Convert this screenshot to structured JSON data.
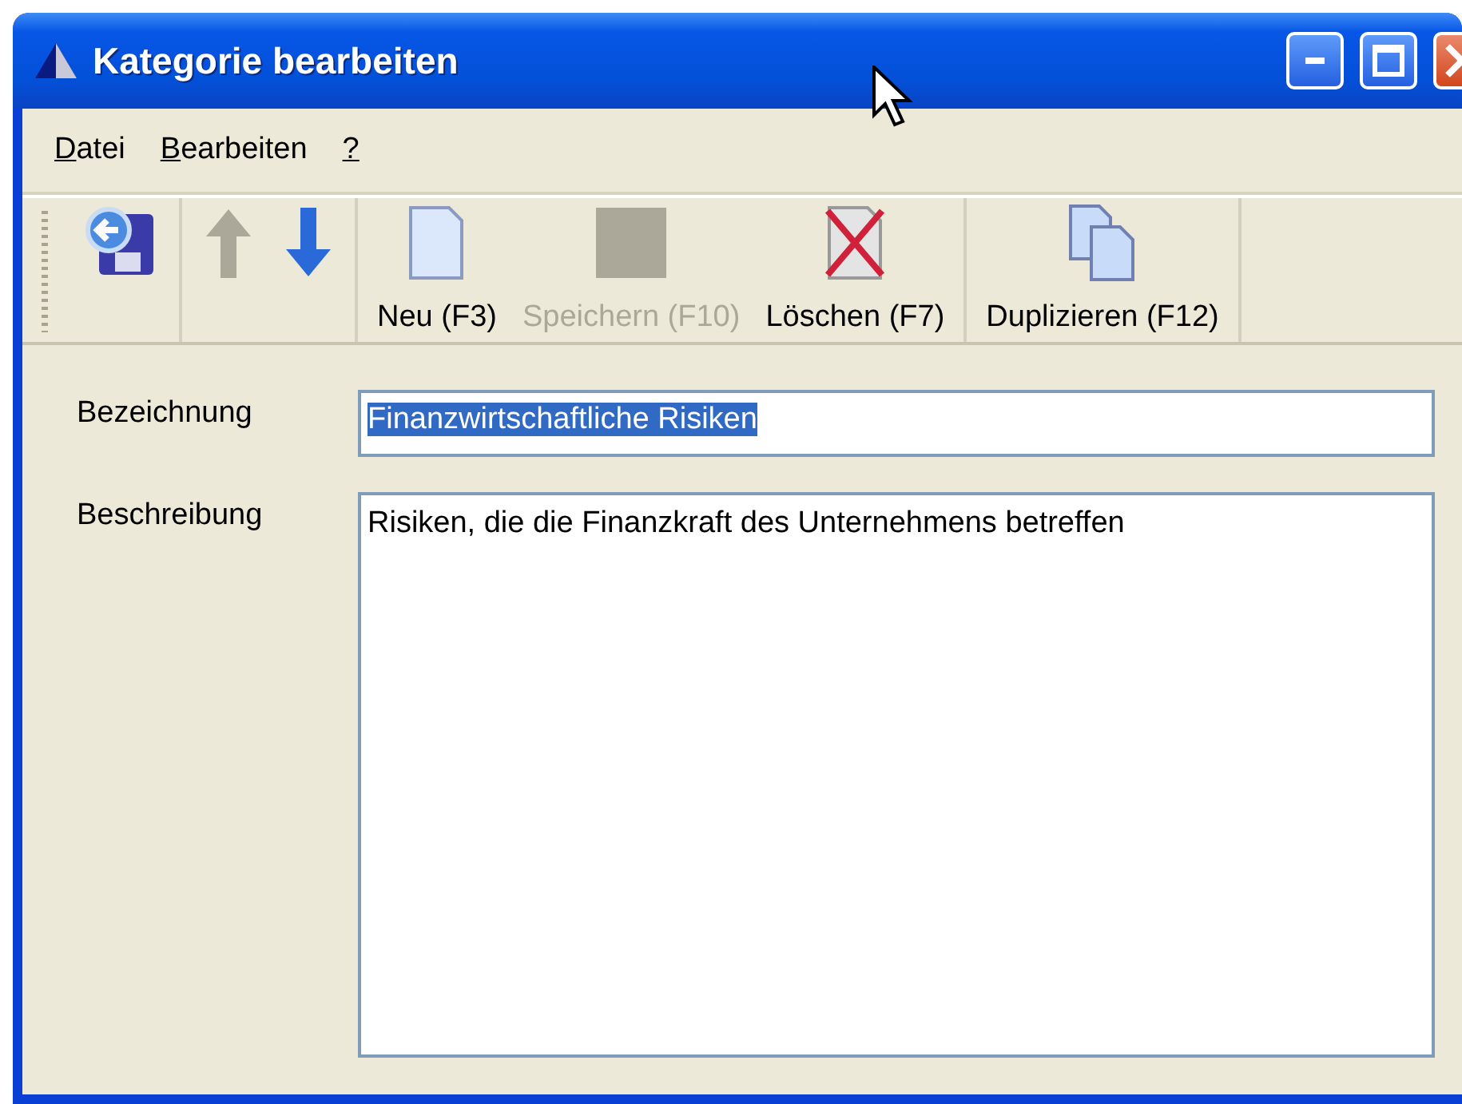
{
  "window": {
    "title": "Kategorie bearbeiten",
    "buttons": [
      {
        "kind": "minimize"
      },
      {
        "kind": "maximize"
      },
      {
        "kind": "close"
      }
    ]
  },
  "menu": [
    {
      "accel": "D",
      "rest": "atei"
    },
    {
      "accel": "B",
      "rest": "earbeiten"
    },
    {
      "accel": "?"
    }
  ],
  "toolbar": {
    "groups": [
      [
        {
          "kind": "back",
          "disabled": false
        }
      ],
      [
        {
          "kind": "up",
          "disabled": true
        },
        {
          "kind": "down",
          "disabled": false
        }
      ],
      [
        {
          "kind": "new",
          "label": "Neu (F3)",
          "disabled": false
        },
        {
          "kind": "save",
          "label": "Speichern (F10)",
          "disabled": true
        },
        {
          "kind": "delete",
          "label": "Löschen (F7)",
          "disabled": false
        }
      ],
      [
        {
          "kind": "duplicate",
          "label": "Duplizieren (F12)",
          "disabled": false
        }
      ]
    ]
  },
  "form": {
    "fields": [
      {
        "kind": "line",
        "label": "Bezeichnung",
        "value": "Finanzwirtschaftliche Risiken",
        "selected": true
      },
      {
        "kind": "area",
        "label": "Beschreibung",
        "value": "Risiken, die die Finanzkraft des Unternehmens betreffen",
        "selected": false
      }
    ]
  }
}
